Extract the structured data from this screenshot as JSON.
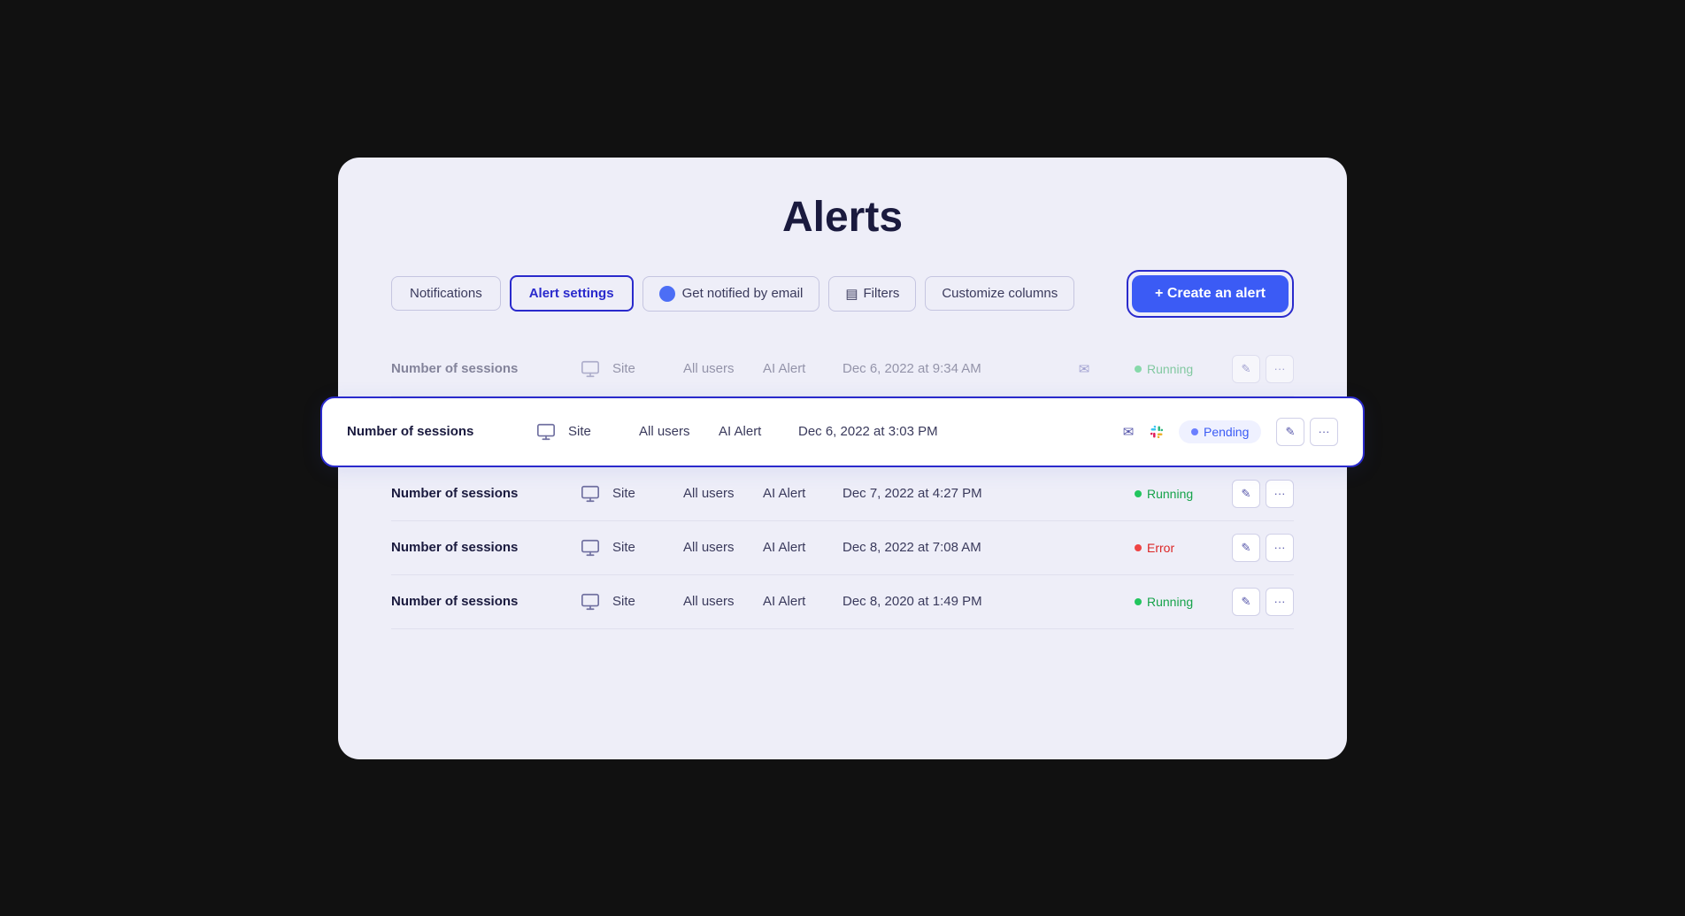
{
  "page": {
    "title": "Alerts",
    "background_color": "#eeeef8"
  },
  "toolbar": {
    "tab_notifications": "Notifications",
    "tab_alert_settings": "Alert settings",
    "email_toggle_label": "Get notified by email",
    "filters_label": "Filters",
    "customize_label": "Customize columns",
    "create_alert_label": "+ Create an alert"
  },
  "alerts": [
    {
      "name": "Number of sessions",
      "icon": "monitor-icon",
      "site": "Site",
      "users": "All users",
      "type": "AI Alert",
      "date": "Dec 6, 2022 at 9:34 AM",
      "notifications": [
        "email"
      ],
      "status": "running",
      "status_label": "Running",
      "highlighted": false,
      "dimmed": true
    },
    {
      "name": "Number of sessions",
      "icon": "monitor-icon",
      "site": "Site",
      "users": "All users",
      "type": "AI Alert",
      "date": "Dec 6, 2022 at 3:03 PM",
      "notifications": [
        "email",
        "slack"
      ],
      "status": "pending",
      "status_label": "Pending",
      "highlighted": true,
      "dimmed": false
    },
    {
      "name": "Number of sessions",
      "icon": "monitor-icon",
      "site": "Site",
      "users": "All users",
      "type": "AI Alert",
      "date": "Dec 7, 2022 at 4:27 PM",
      "notifications": [],
      "status": "running",
      "status_label": "Running",
      "highlighted": false,
      "dimmed": false
    },
    {
      "name": "Number of sessions",
      "icon": "monitor-icon",
      "site": "Site",
      "users": "All users",
      "type": "AI Alert",
      "date": "Dec 8, 2022 at 7:08 AM",
      "notifications": [],
      "status": "error",
      "status_label": "Error",
      "highlighted": false,
      "dimmed": false
    },
    {
      "name": "Number of sessions",
      "icon": "monitor-icon",
      "site": "Site",
      "users": "All users",
      "type": "AI Alert",
      "date": "Dec 8, 2020 at 1:49 PM",
      "notifications": [],
      "status": "running",
      "status_label": "Running",
      "highlighted": false,
      "dimmed": false
    }
  ],
  "icons": {
    "edit": "✎",
    "more": "···",
    "email": "✉",
    "filter": "⚙",
    "plus": "+"
  }
}
